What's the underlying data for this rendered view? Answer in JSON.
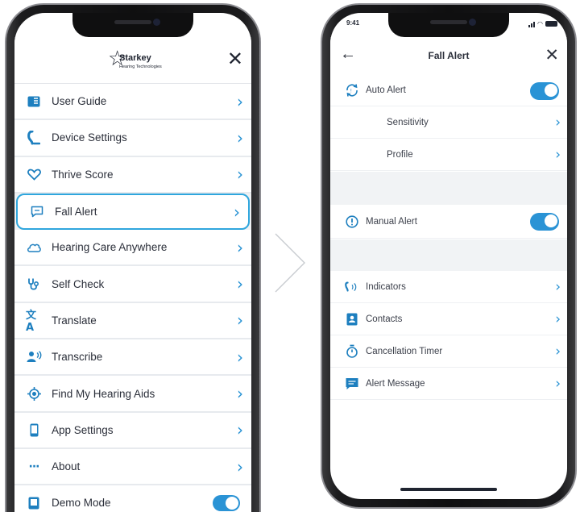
{
  "left_screen": {
    "logo": {
      "brand": "Starkey",
      "sub": "Hearing Technologies"
    },
    "close_glyph": "✕",
    "menu": [
      {
        "label": "User Guide",
        "icon": "book-icon"
      },
      {
        "label": "Device Settings",
        "icon": "hearing-aid-icon"
      },
      {
        "label": "Thrive Score",
        "icon": "heart-icon"
      },
      {
        "label": "Fall Alert",
        "icon": "chat-bubble-icon",
        "active": true
      },
      {
        "label": "Hearing Care Anywhere",
        "icon": "cloud-icon"
      },
      {
        "label": "Self Check",
        "icon": "stethoscope-icon"
      },
      {
        "label": "Translate",
        "icon": "translate-icon"
      },
      {
        "label": "Transcribe",
        "icon": "speaking-person-icon"
      },
      {
        "label": "Find My Hearing Aids",
        "icon": "location-target-icon"
      },
      {
        "label": "App Settings",
        "icon": "phone-icon"
      },
      {
        "label": "About",
        "icon": "ellipsis-icon"
      },
      {
        "label": "Demo Mode",
        "icon": "demo-icon",
        "toggle": "on"
      }
    ]
  },
  "right_screen": {
    "status_time": "9:41",
    "nav": {
      "back": "←",
      "title": "Fall Alert",
      "close": "✕"
    },
    "rows": {
      "auto_alert": "Auto Alert",
      "sensitivity": "Sensitivity",
      "profile": "Profile",
      "manual_alert": "Manual Alert",
      "indicators": "Indicators",
      "contacts": "Contacts",
      "cancellation_timer": "Cancellation Timer",
      "alert_message": "Alert Message"
    },
    "toggles": {
      "auto_alert": "on",
      "manual_alert": "on"
    }
  },
  "colors": {
    "accent": "#2490d3",
    "toggle": "#2a93d5",
    "active_border": "#2fa6dd"
  }
}
